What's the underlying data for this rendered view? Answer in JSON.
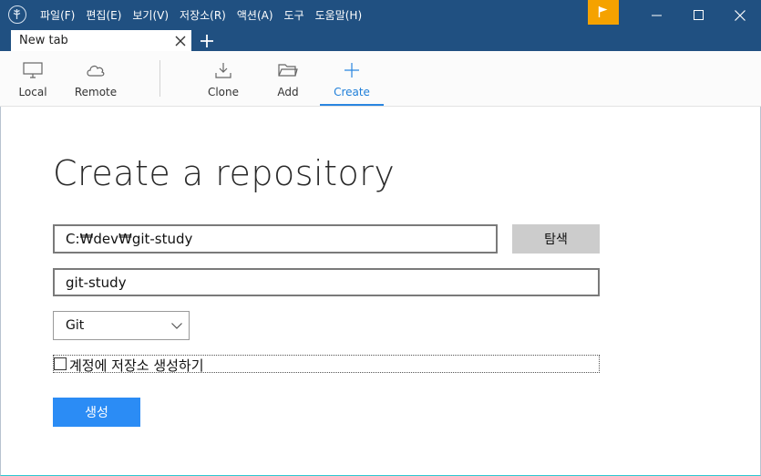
{
  "window": {
    "menu": [
      "파일(F)",
      "편집(E)",
      "보기(V)",
      "저장소(R)",
      "액션(A)",
      "도구",
      "도움말(H)"
    ],
    "colors": {
      "titlebar": "#205081",
      "flag": "#f5a200",
      "accent": "#2b8cf5"
    }
  },
  "tabs": {
    "active_label": "New tab"
  },
  "toolbar": {
    "local": "Local",
    "remote": "Remote",
    "clone": "Clone",
    "add": "Add",
    "create": "Create",
    "selected": "Create"
  },
  "form": {
    "title": "Create a repository",
    "path_value": "C:₩dev₩git-study",
    "browse_label": "탐색",
    "name_value": "git-study",
    "vcs_selected": "Git",
    "account_checkbox_label": "계정에 저장소 생성하기",
    "account_checkbox_checked": false,
    "create_label": "생성"
  },
  "icons": [
    "sourcetree-logo-icon",
    "flag-icon",
    "minimize-icon",
    "maximize-icon",
    "close-icon",
    "tab-close-icon",
    "add-tab-icon",
    "monitor-icon",
    "cloud-icon",
    "download-icon",
    "folder-icon",
    "plus-icon",
    "chevron-down-icon"
  ]
}
